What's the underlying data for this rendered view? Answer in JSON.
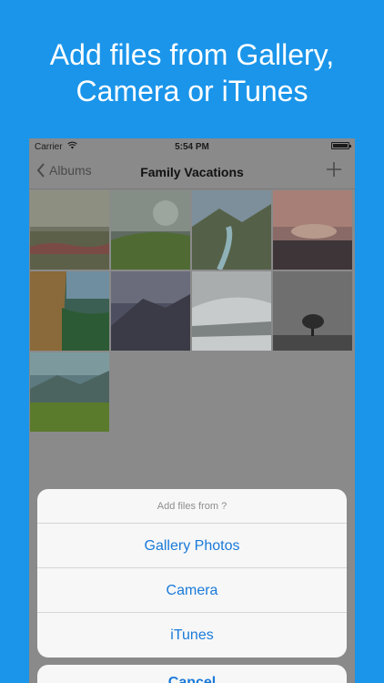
{
  "headline": {
    "line1": "Add files from Gallery,",
    "line2": "Camera or iTunes"
  },
  "status_bar": {
    "carrier": "Carrier",
    "time": "5:54 PM"
  },
  "nav": {
    "back_label": "Albums",
    "title": "Family Vacations",
    "add_icon": "plus-icon"
  },
  "photos_count": 9,
  "action_sheet": {
    "heading": "Add files from ?",
    "options": [
      "Gallery Photos",
      "Camera",
      "iTunes"
    ],
    "cancel": "Cancel"
  },
  "colors": {
    "background": "#1a95ea",
    "accent": "#1a7ad9",
    "sheet": "#f7f7f7"
  }
}
